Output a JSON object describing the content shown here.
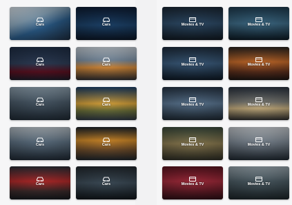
{
  "groups": [
    {
      "category": "Cars",
      "tiles": [
        {
          "label": "Cars",
          "icon": "car-icon"
        },
        {
          "label": "Cars",
          "icon": "car-icon"
        },
        {
          "label": "Cars",
          "icon": "car-icon"
        },
        {
          "label": "Cars",
          "icon": "car-icon"
        },
        {
          "label": "Cars",
          "icon": "car-icon"
        },
        {
          "label": "Cars",
          "icon": "car-icon"
        },
        {
          "label": "Cars",
          "icon": "car-icon"
        },
        {
          "label": "Cars",
          "icon": "car-icon"
        },
        {
          "label": "Cars",
          "icon": "car-icon"
        },
        {
          "label": "Cars",
          "icon": "car-icon"
        }
      ]
    },
    {
      "category": "Movies & TV",
      "tiles": [
        {
          "label": "Movies & TV",
          "icon": "film-icon"
        },
        {
          "label": "Movies & TV",
          "icon": "film-icon"
        },
        {
          "label": "Movies & TV",
          "icon": "film-icon"
        },
        {
          "label": "Movies & TV",
          "icon": "film-icon"
        },
        {
          "label": "Movies & TV",
          "icon": "film-icon"
        },
        {
          "label": "Movies & TV",
          "icon": "film-icon"
        },
        {
          "label": "Movies & TV",
          "icon": "film-icon"
        },
        {
          "label": "Movies & TV",
          "icon": "film-icon"
        },
        {
          "label": "Movies & TV",
          "icon": "film-icon"
        },
        {
          "label": "Movies & TV",
          "icon": "film-icon"
        }
      ]
    }
  ]
}
